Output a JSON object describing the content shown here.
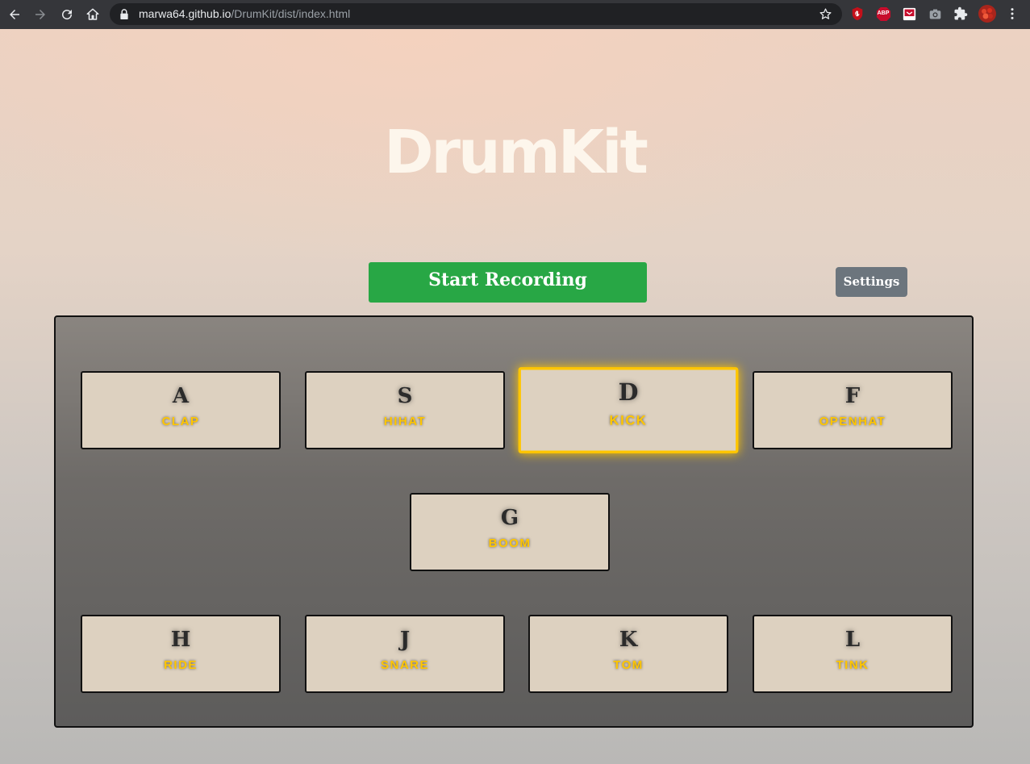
{
  "browser": {
    "url_host": "marwa64.github.io",
    "url_path": "/DrumKit/dist/index.html",
    "icons": [
      "back-icon",
      "forward-icon",
      "reload-icon",
      "home-icon",
      "lock-icon",
      "bookmark-star-icon",
      "extension-ublock-icon",
      "extension-abp-icon",
      "extension-pocket-icon",
      "extension-camera-icon",
      "extensions-puzzle-icon",
      "profile-avatar-icon",
      "menu-kebab-icon"
    ],
    "abp_label": "ABP"
  },
  "page": {
    "title": "DrumKit",
    "record_label": "Start Recording",
    "settings_label": "Settings",
    "accent_color": "#ffc600",
    "record_color": "#28a745",
    "settings_color": "#6c757d"
  },
  "keys": [
    {
      "letter": "A",
      "sound": "CLAP"
    },
    {
      "letter": "S",
      "sound": "HIHAT"
    },
    {
      "letter": "D",
      "sound": "KICK",
      "playing": true
    },
    {
      "letter": "F",
      "sound": "OPENHAT"
    },
    {
      "letter": "G",
      "sound": "BOOM"
    },
    {
      "letter": "H",
      "sound": "RIDE"
    },
    {
      "letter": "J",
      "sound": "SNARE"
    },
    {
      "letter": "K",
      "sound": "TOM"
    },
    {
      "letter": "L",
      "sound": "TINK"
    }
  ]
}
